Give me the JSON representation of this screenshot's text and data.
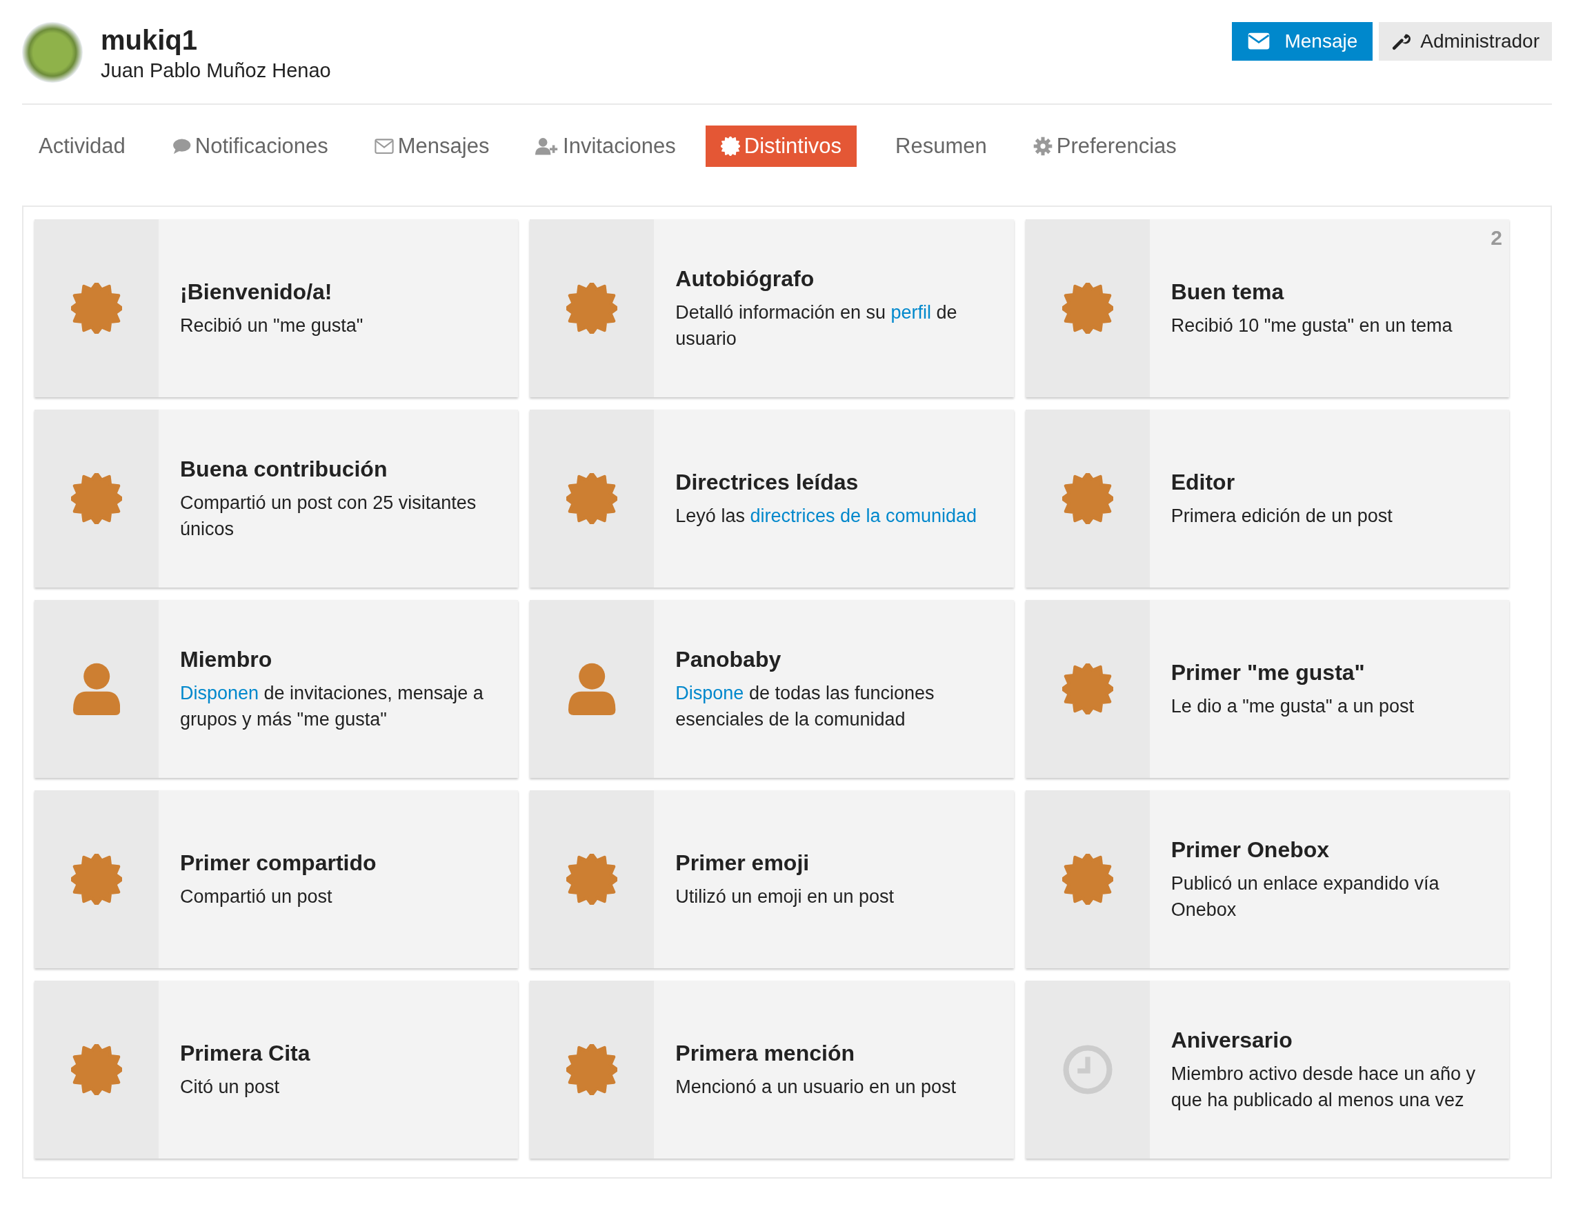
{
  "user": {
    "username": "mukiq1",
    "full_name": "Juan Pablo Muñoz Henao"
  },
  "actions": [
    {
      "label": "Mensaje",
      "kind": "primary"
    },
    {
      "label": "Administrador",
      "kind": "secondary"
    }
  ],
  "tabs": [
    {
      "label": "Actividad",
      "kind": "plain",
      "selected": false
    },
    {
      "label": "Notificaciones",
      "kind": "notifications",
      "selected": false
    },
    {
      "label": "Mensajes",
      "kind": "messages",
      "selected": false
    },
    {
      "label": "Invitaciones",
      "kind": "invites",
      "selected": false
    },
    {
      "label": "Distintivos",
      "kind": "badges",
      "selected": true
    },
    {
      "label": "Resumen",
      "kind": "plain",
      "selected": false
    },
    {
      "label": "Preferencias",
      "kind": "settings",
      "selected": false
    }
  ],
  "badges": [
    {
      "title": "¡Bienvenido/a!",
      "kind": "award",
      "description": [
        {
          "kind": "text",
          "text": "Recibió un \"me gusta\""
        }
      ]
    },
    {
      "title": "Autobiógrafo",
      "kind": "award",
      "description": [
        {
          "kind": "text",
          "text": "Detalló información en su "
        },
        {
          "kind": "link",
          "text": "perfil"
        },
        {
          "kind": "text",
          "text": " de usuario"
        }
      ]
    },
    {
      "title": "Buen tema",
      "kind": "award",
      "count": "2",
      "description": [
        {
          "kind": "text",
          "text": "Recibió 10 \"me gusta\" en un tema"
        }
      ]
    },
    {
      "title": "Buena contribución",
      "kind": "award",
      "description": [
        {
          "kind": "text",
          "text": "Compartió un post con 25 visitantes únicos"
        }
      ]
    },
    {
      "title": "Directrices leídas",
      "kind": "award",
      "description": [
        {
          "kind": "text",
          "text": "Leyó las "
        },
        {
          "kind": "link",
          "text": "directrices de la comunidad"
        }
      ]
    },
    {
      "title": "Editor",
      "kind": "award",
      "description": [
        {
          "kind": "text",
          "text": "Primera edición de un post"
        }
      ]
    },
    {
      "title": "Miembro",
      "kind": "member",
      "description": [
        {
          "kind": "link",
          "text": "Disponen"
        },
        {
          "kind": "text",
          "text": " de invitaciones, mensaje a grupos y más \"me gusta\""
        }
      ]
    },
    {
      "title": "Panobaby",
      "kind": "member",
      "description": [
        {
          "kind": "link",
          "text": "Dispone"
        },
        {
          "kind": "text",
          "text": " de todas las funciones esenciales de la comunidad"
        }
      ]
    },
    {
      "title": "Primer \"me gusta\"",
      "kind": "award",
      "description": [
        {
          "kind": "text",
          "text": "Le dio a \"me gusta\" a un post"
        }
      ]
    },
    {
      "title": "Primer compartido",
      "kind": "award",
      "description": [
        {
          "kind": "text",
          "text": "Compartió un post"
        }
      ]
    },
    {
      "title": "Primer emoji",
      "kind": "award",
      "description": [
        {
          "kind": "text",
          "text": "Utilizó un emoji en un post"
        }
      ]
    },
    {
      "title": "Primer Onebox",
      "kind": "award",
      "description": [
        {
          "kind": "text",
          "text": "Publicó un enlace expandido vía Onebox"
        }
      ]
    },
    {
      "title": "Primera Cita",
      "kind": "award",
      "description": [
        {
          "kind": "text",
          "text": "Citó un post"
        }
      ]
    },
    {
      "title": "Primera mención",
      "kind": "award",
      "description": [
        {
          "kind": "text",
          "text": "Mencionó a un usuario en un post"
        }
      ]
    },
    {
      "title": "Aniversario",
      "kind": "anniversary",
      "description": [
        {
          "kind": "text",
          "text": "Miembro activo desde hace un año y que ha publicado al menos una vez"
        }
      ]
    }
  ]
}
